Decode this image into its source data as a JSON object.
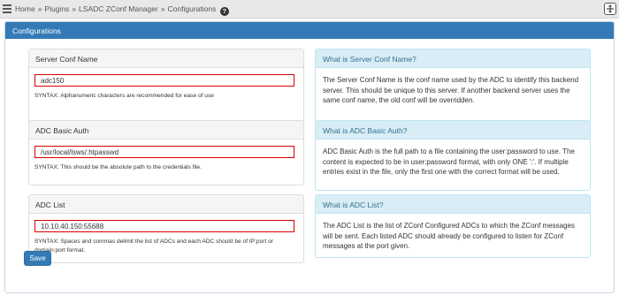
{
  "breadcrumb": {
    "items": [
      "Home",
      "Plugins",
      "LSADC ZConf Manager",
      "Configurations"
    ],
    "separator": "»"
  },
  "panel": {
    "title": "Configurations"
  },
  "fields": [
    {
      "label": "Server Conf Name",
      "value": "adc150",
      "syntax": "SYNTAX: Alphanumeric characters are recommended for ease of use",
      "help_title": "What is Server Conf Name?",
      "help_text": "The Server Conf Name is the conf name used by the ADC to identify this backend server. This should be unique to this server. If another backend server uses the same conf name, the old conf will be overridden."
    },
    {
      "label": "ADC Basic Auth",
      "value": "/usr/local/lsws/.htpasswd",
      "syntax": "SYNTAX: This should be the absolute path to the credentials file.",
      "help_title": "What is ADC Basic Auth?",
      "help_text": "ADC Basic Auth is the full path to a file containing the user:password to use. The content is expected to be in user:password format, with only ONE ':'. If multiple entries exist in the file, only the first one with the correct format will be used."
    },
    {
      "label": "ADC List",
      "value": "10.10.40.150:55688",
      "syntax": "SYNTAX: Spaces and commas delimit the list of ADCs and each ADC should be of IP:port or domain:port format.",
      "help_title": "What is ADC List?",
      "help_text": "The ADC List is the list of ZConf Configured ADCs to which the ZConf messages will be sent. Each listed ADC should already be configured to listen for ZConf messages at the port given."
    }
  ],
  "actions": {
    "save_label": "Save"
  },
  "icons": {
    "menu": "menu-icon",
    "help": "question-circle-icon",
    "top_right": "window-toggle-icon"
  },
  "colors": {
    "primary": "#337ab7",
    "info_bg": "#d9edf7",
    "info_text": "#31708f",
    "error_border": "#dd0000"
  }
}
